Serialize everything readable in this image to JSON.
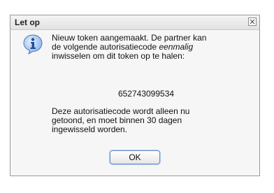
{
  "dialog": {
    "title": "Let op",
    "close_icon": "close-icon",
    "info_icon": "info-icon",
    "message_line1": "Nieuw token aangemaakt. De partner kan",
    "message_line2_prefix": "de volgende autorisatiecode ",
    "message_line2_emphasis": "eenmalig",
    "message_line3": "inwisselen om dit token op te halen:",
    "token": "652743099534",
    "note_line1": "Deze autorisatiecode wordt alleen nu",
    "note_line2": "getoond, en moet binnen 30 dagen",
    "note_line3": "ingewisseld worden.",
    "ok_label": "OK"
  }
}
